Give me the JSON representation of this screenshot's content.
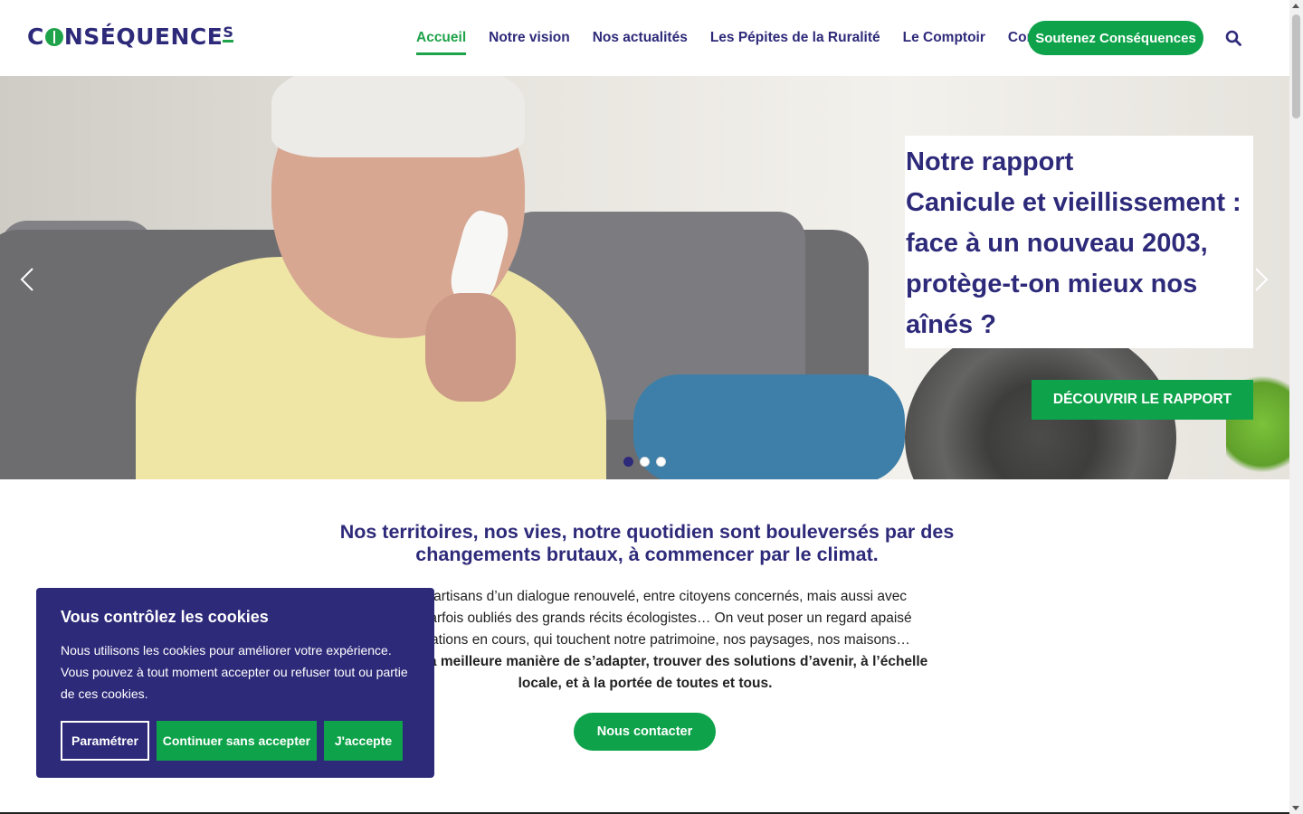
{
  "header": {
    "logo_text": "CONSÉQUENCES",
    "nav": [
      {
        "label": "Accueil",
        "active": true
      },
      {
        "label": "Notre vision"
      },
      {
        "label": "Nos actualités"
      },
      {
        "label": "Les Pépites de la Ruralité"
      },
      {
        "label": "Le Comptoir"
      },
      {
        "label": "Contact"
      }
    ],
    "support_button": "Soutenez Conséquences",
    "search_icon": "search-icon"
  },
  "hero": {
    "card_lines": [
      "Notre rapport",
      "Canicule et vieillissement :",
      "face à un nouveau 2003,",
      "protège-t-on mieux nos",
      "aînés ?"
    ],
    "cta": "DÉCOUVRIR LE RAPPORT",
    "slides_count": 3,
    "active_slide": 1
  },
  "intro": {
    "title": "Nos territoires, nos vies, notre quotidien sont bouleversés par des changements brutaux, à commencer par le climat.",
    "text_lines": [
      "on est partisans d’un dialogue renouvelé, entre citoyens concernés, mais aussi avec",
      "entent parfois oubliés des grands récits écologistes… On veut poser un regard apaisé",
      "ansformations en cours, qui touchent notre patrimoine, nos paysages, nos maisons…"
    ],
    "bold_lines": [
      "mble sur la meilleure manière de s’adapter, trouver des solutions d’avenir, à l’échelle",
      "locale, et à la portée de toutes et tous."
    ],
    "contact_button": "Nous contacter"
  },
  "cookie": {
    "title": "Vous contrôlez les cookies",
    "text": "Nous utilisons les cookies pour améliorer votre expérience. Vous pouvez à tout moment accepter ou refuser tout ou partie de ces cookies.",
    "btn_settings": "Paramétrer",
    "btn_decline": "Continuer sans accepter",
    "btn_accept": "J'accepte"
  },
  "colors": {
    "brand_purple": "#2e2a7a",
    "brand_green": "#0ea34a"
  }
}
